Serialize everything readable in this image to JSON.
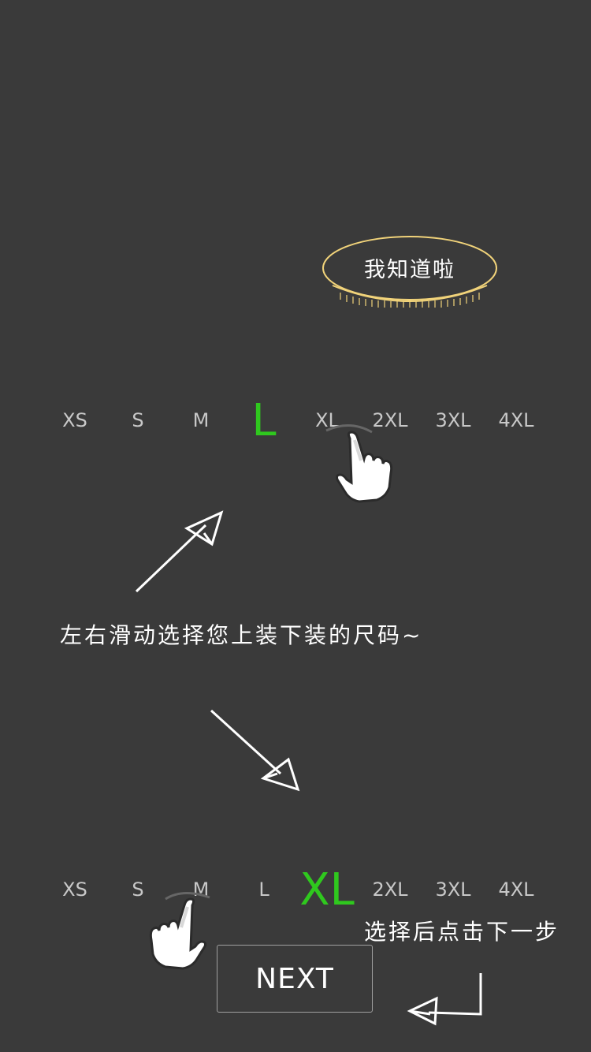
{
  "got_it_button": {
    "label": "我知道啦",
    "outline_color": "#f1d37a"
  },
  "size_selector_top": {
    "sizes": [
      "XS",
      "S",
      "M",
      "L",
      "XL",
      "2XL",
      "3XL",
      "4XL"
    ],
    "selected": "L"
  },
  "size_selector_bottom": {
    "sizes": [
      "XS",
      "S",
      "M",
      "L",
      "XL",
      "2XL",
      "3XL",
      "4XL"
    ],
    "selected": "XL"
  },
  "hints": {
    "swipe": "左右滑动选择您上装下装的尺码~",
    "next": "选择后点击下一步"
  },
  "next_button": {
    "label": "NEXT"
  },
  "colors": {
    "background": "#3a3a3a",
    "selected": "#2fc81e",
    "size_text": "#c8c8c8"
  },
  "icons": [
    "hand-pointer-icon",
    "arrow-up-right-icon",
    "arrow-down-right-icon",
    "return-arrow-icon"
  ]
}
